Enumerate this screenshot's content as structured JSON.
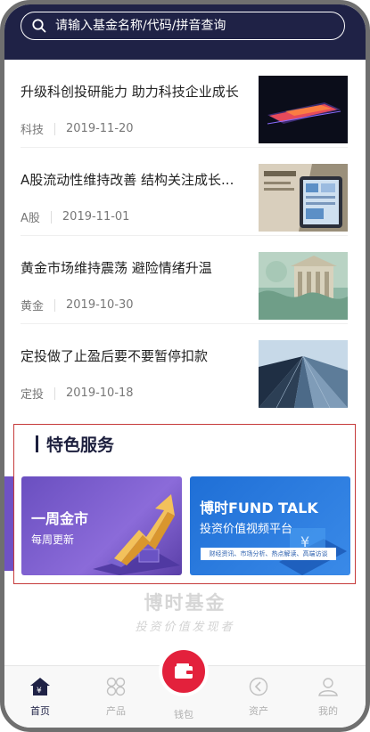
{
  "search": {
    "placeholder": "请输入基金名称/代码/拼音查询"
  },
  "news": [
    {
      "title": "升级科创投研能力 助力科技企业成长",
      "tag": "科技",
      "date": "2019-11-20"
    },
    {
      "title": "A股流动性维持改善 结构关注成长...",
      "tag": "A股",
      "date": "2019-11-01"
    },
    {
      "title": "黄金市场维持震荡 避险情绪升温",
      "tag": "黄金",
      "date": "2019-10-30"
    },
    {
      "title": "定投做了止盈后要不要暂停扣款",
      "tag": "定投",
      "date": "2019-10-18"
    }
  ],
  "featured": {
    "heading": "特色服务",
    "left_card": {
      "title": "一周金市",
      "subtitle": "每周更新"
    },
    "right_card": {
      "title": "博时FUND TALK",
      "subtitle": "投资价值视频平台",
      "tags": "财经资讯、市场分析、热点解读、高端访谈"
    }
  },
  "brand": {
    "name": "博时基金",
    "slogan": "投资价值发现者"
  },
  "tabs": {
    "home": "首页",
    "products": "产品",
    "wallet": "钱包",
    "assets": "资产",
    "mine": "我的"
  },
  "colors": {
    "header": "#1f2246",
    "accent": "#e3213c",
    "featured_border": "#c63b3b"
  }
}
